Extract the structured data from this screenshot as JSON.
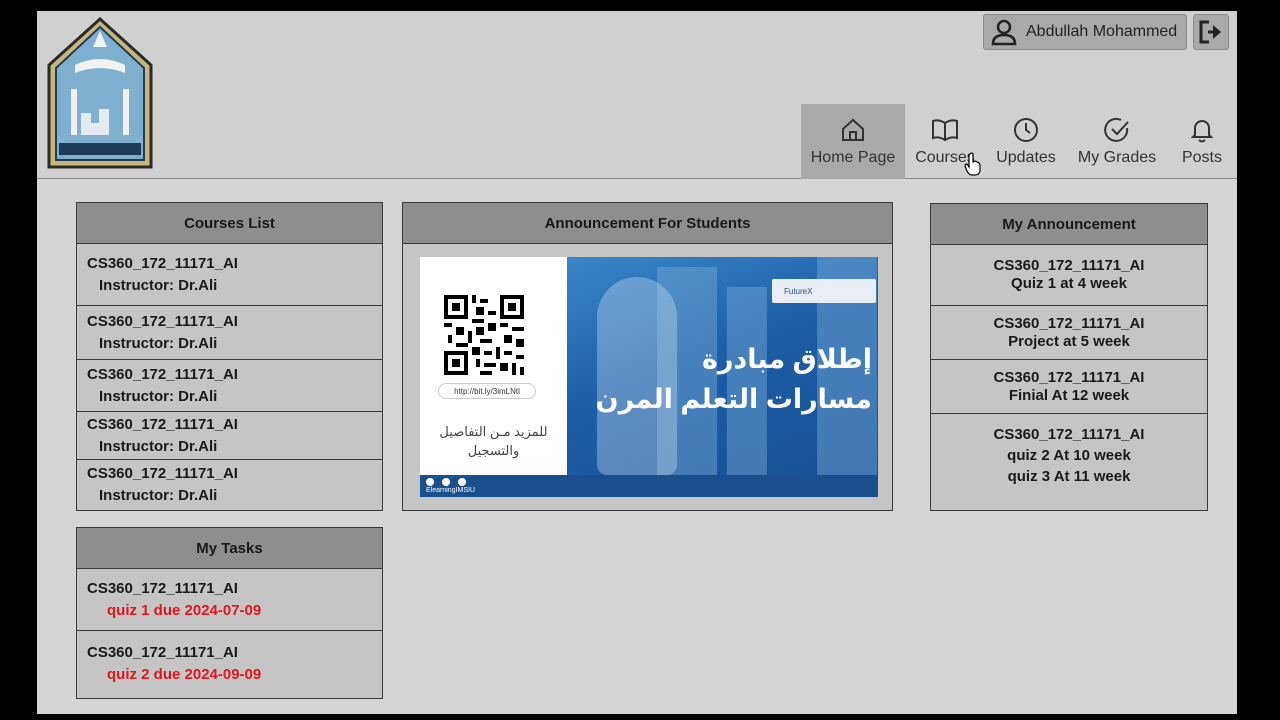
{
  "user": {
    "name": "Abdullah Mohammed"
  },
  "nav": [
    {
      "label": "Home Page",
      "icon": "home-icon"
    },
    {
      "label": "Courses",
      "icon": "book-icon"
    },
    {
      "label": "Updates",
      "icon": "clock-icon"
    },
    {
      "label": "My Grades",
      "icon": "check-circle-icon"
    },
    {
      "label": "Posts",
      "icon": "bell-icon"
    }
  ],
  "courses_list": {
    "title": "Courses List",
    "items": [
      {
        "code": "CS360_172_11171_AI",
        "instructor": "Instructor: Dr.Ali"
      },
      {
        "code": "CS360_172_11171_AI",
        "instructor": "Instructor: Dr.Ali"
      },
      {
        "code": "CS360_172_11171_AI",
        "instructor": "Instructor: Dr.Ali"
      },
      {
        "code": "CS360_172_11171_AI",
        "instructor": "Instructor: Dr.Ali"
      },
      {
        "code": "CS360_172_11171_AI",
        "instructor": "Instructor: Dr.Ali"
      }
    ]
  },
  "announcement": {
    "title": "Announcement For Students",
    "banner": {
      "headline_1": "إطلاق مبادرة",
      "headline_2": "مسارات التعلم المرن",
      "url": "http://bit.ly/3imLNtl",
      "more_line_1": "للمزيد مـن التفاصيل",
      "more_line_2": "والتسجيل",
      "brand": "FutureX",
      "footer_tag": "ElearningIMSIU"
    }
  },
  "my_announcement": {
    "title": "My Announcement",
    "items": [
      {
        "code": "CS360_172_11171_AI",
        "lines": [
          "Quiz 1 at 4 week"
        ]
      },
      {
        "code": "CS360_172_11171_AI",
        "lines": [
          "Project at 5 week"
        ]
      },
      {
        "code": "CS360_172_11171_AI",
        "lines": [
          "Finial At 12 week"
        ]
      },
      {
        "code": "CS360_172_11171_AI",
        "lines": [
          "quiz 2 At 10 week",
          "quiz 3 At 11 week"
        ]
      }
    ]
  },
  "tasks": {
    "title": "My Tasks",
    "items": [
      {
        "code": "CS360_172_11171_AI",
        "due": "quiz 1 due 2024-07-09"
      },
      {
        "code": "CS360_172_11171_AI",
        "due": "quiz 2 due 2024-09-09"
      }
    ]
  },
  "colors": {
    "due_red": "#e0171e",
    "banner_blue": "#1f64a8"
  }
}
